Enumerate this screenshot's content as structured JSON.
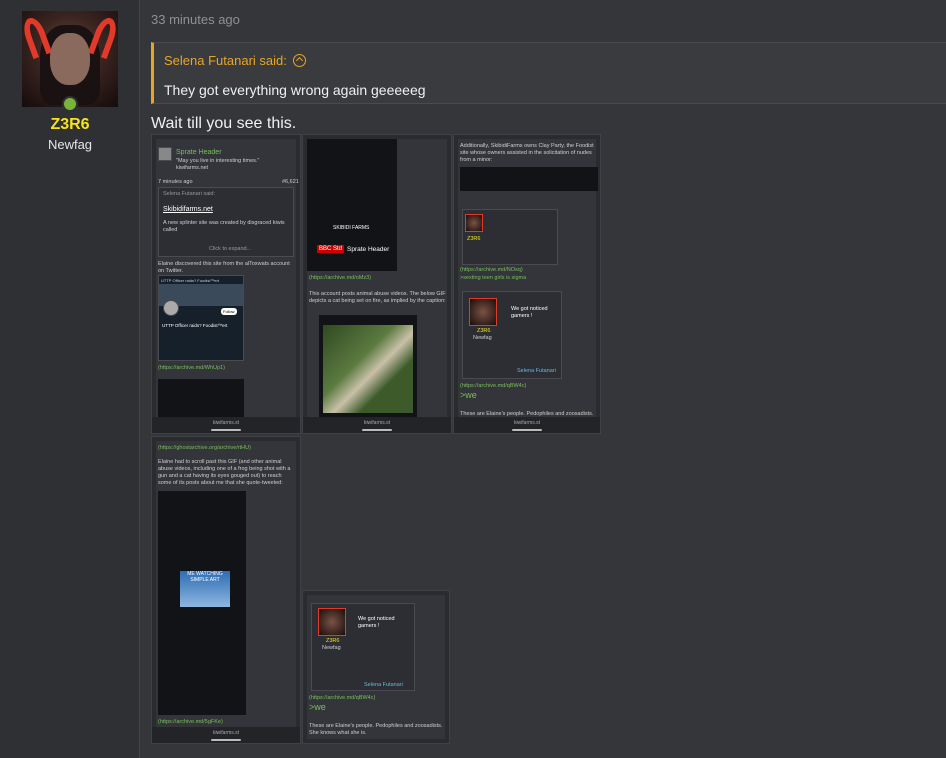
{
  "post": {
    "timestamp": "33 minutes ago",
    "author": {
      "name": "Z3R6",
      "title": "Newfag"
    },
    "quote": {
      "attribution": "Selena Futanari said:",
      "text": "They got everything wrong again geeeeeg"
    },
    "body": "Wait till you see this."
  },
  "attachments": {
    "footer": "kiwifarms.st",
    "a1": {
      "header": "Sprate Header",
      "quote": "\"May you live in interesting times.\"",
      "site": "kiwifarms.net",
      "time": "7 minutes ago",
      "num": "#6,621",
      "said": "Selena Futanari said:",
      "link": "Skibidifarms.net",
      "text1": "A new splinter site was created by disgraced kiwis called",
      "expand": "Click to expand...",
      "text2": "Elaine discovered this site from the alToxwats account on Twitter.",
      "tw_title": "UTTP Officer raids? Foodist™ert",
      "follow": "Follow",
      "archive": "(https://archive.md/WhUp1)"
    },
    "a2": {
      "brand": "SKIBIDI FARMS",
      "bbc": "BBC Std",
      "header": "Sprate Header",
      "archive": "(https://archive.md/oMz3)",
      "text": "This account posts animal abuse videos. The below GIF depicts a cat being set on fire, as implied by the caption:"
    },
    "a3": {
      "text": "Additionally, SkibidiFarms owns Clay Party, the Foodist site whose owners assisted in the solicitation of nudes from a minor:",
      "archive1": "(https://archive.md/NOsq)",
      "quote1": ">sexting teen girls is sigma",
      "name": "Z3R6",
      "title": "Newfag",
      "noticed": "We got noticed gamers !",
      "selena": "Selena Futanari",
      "archive2": "(https://archive.md/qBW4c)",
      "we": ">we",
      "bottom": "These are Elaine's people. Pedophiles and zoosadists."
    },
    "a4": {
      "archive1": "(https://ghostarchive.org/archive/rtHU)",
      "text": "Elaine had to scroll past this GIF (and other animal abuse videos, including one of a frog being shot with a gun and a cat having its eyes gouged out) to reach some of its posts about me that she quote-tweeted:",
      "meme": "ME WATCHING SIMPLE ART",
      "archive2": "(https://archive.md/5gFKe)"
    },
    "a5": {
      "name": "Z3R6",
      "title": "Newfag",
      "noticed": "We got noticed gamers !",
      "selena": "Selena Futanari",
      "archive": "(https://archive.md/qBW4c)",
      "we": ">we",
      "bottom": "These are Elaine's people. Pedophiles and zoosadists. She knows what she is."
    }
  }
}
